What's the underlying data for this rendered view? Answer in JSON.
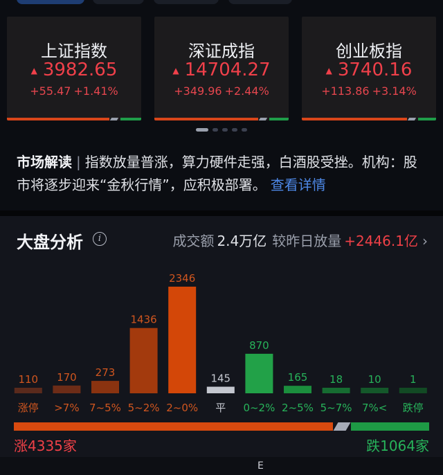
{
  "indices": [
    {
      "name": "上证指数",
      "price": "3982.65",
      "change": "+55.47",
      "pct": "+1.41%",
      "arrow": "▲"
    },
    {
      "name": "深证成指",
      "price": "14704.27",
      "change": "+349.96",
      "pct": "+2.44%",
      "arrow": "▲"
    },
    {
      "name": "创业板指",
      "price": "3740.16",
      "change": "+113.86",
      "pct": "+3.14%",
      "arrow": "▲"
    }
  ],
  "market_interpretation": {
    "label": "市场解读",
    "separator": "|",
    "text": "指数放量普涨，算力硬件走强，白酒股受挫。机构：股市将逐步迎来“金秋行情”，应积极部署。",
    "more": "查看详情"
  },
  "analysis": {
    "title": "大盘分析",
    "info_icon": "i",
    "turnover_label": "成交额",
    "turnover_value": "2.4万亿",
    "compare_label": "较昨日放量",
    "compare_value": "+2446.1亿",
    "chevron": "›",
    "rise_total": "涨4335家",
    "fall_total": "跌1064家",
    "rise_count": 4335,
    "flat_count": 145,
    "fall_count": 1064
  },
  "chart_data": {
    "type": "bar",
    "categories": [
      "涨停",
      ">7%",
      "7~5%",
      "5~2%",
      "2~0%",
      "平",
      "0~2%",
      "2~5%",
      "5~7%",
      "7%<",
      "跌停"
    ],
    "values": [
      110,
      170,
      273,
      1436,
      2346,
      145,
      870,
      165,
      18,
      10,
      1
    ],
    "colors": [
      "#5a2a1c",
      "#6d2c17",
      "#8a3310",
      "#a33a0d",
      "#d34708",
      "#c4c7cf",
      "#22a148",
      "#1b8e3d",
      "#166c31",
      "#14582a",
      "#124a24"
    ],
    "label_colors": [
      "#d1561f",
      "#d1561f",
      "#d1561f",
      "#d1561f",
      "#d1561f",
      "#c4c7cf",
      "#27b35a",
      "#27b35a",
      "#27b35a",
      "#27b35a",
      "#27b35a"
    ]
  },
  "nav_handle": "E"
}
